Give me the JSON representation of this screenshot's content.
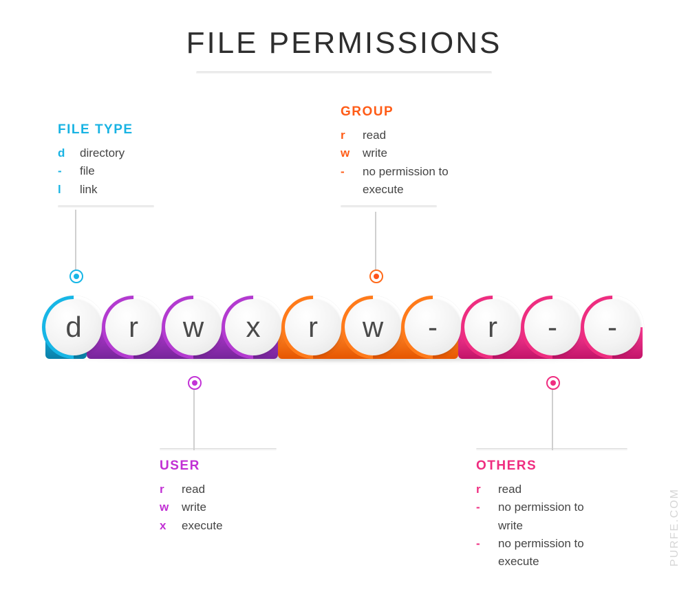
{
  "title": "FILE PERMISSIONS",
  "watermark": "PURFE.COM",
  "circles": [
    {
      "char": "d",
      "group": "filetype"
    },
    {
      "char": "r",
      "group": "user"
    },
    {
      "char": "w",
      "group": "user"
    },
    {
      "char": "x",
      "group": "user"
    },
    {
      "char": "r",
      "group": "group"
    },
    {
      "char": "w",
      "group": "group"
    },
    {
      "char": "-",
      "group": "group"
    },
    {
      "char": "r",
      "group": "others"
    },
    {
      "char": "-",
      "group": "others"
    },
    {
      "char": "-",
      "group": "others"
    }
  ],
  "sections": {
    "filetype": {
      "heading": "FILE TYPE",
      "color": "cyan",
      "items": [
        {
          "sym": "d",
          "label": "directory"
        },
        {
          "sym": "-",
          "label": "file"
        },
        {
          "sym": "l",
          "label": "link"
        }
      ]
    },
    "user": {
      "heading": "USER",
      "color": "purple",
      "items": [
        {
          "sym": "r",
          "label": "read"
        },
        {
          "sym": "w",
          "label": "write"
        },
        {
          "sym": "x",
          "label": "execute"
        }
      ]
    },
    "group": {
      "heading": "GROUP",
      "color": "orange",
      "items": [
        {
          "sym": "r",
          "label": "read"
        },
        {
          "sym": "w",
          "label": "write"
        },
        {
          "sym": "-",
          "label": "no permission to execute"
        }
      ]
    },
    "others": {
      "heading": "OTHERS",
      "color": "pink",
      "items": [
        {
          "sym": "r",
          "label": "read"
        },
        {
          "sym": "-",
          "label": "no permission to write"
        },
        {
          "sym": "-",
          "label": "no permission to execute"
        }
      ]
    }
  }
}
